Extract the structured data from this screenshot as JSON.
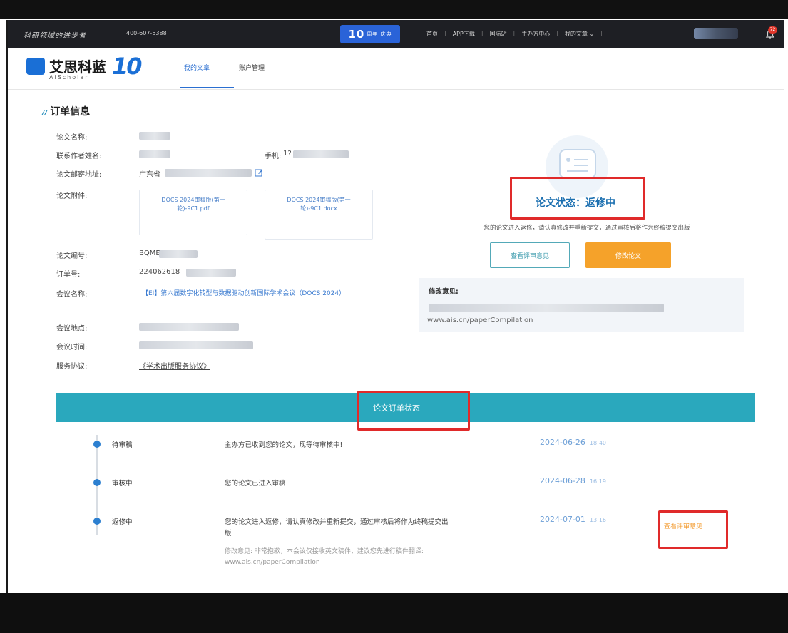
{
  "topbar": {
    "slogan": "科研领域的进步者",
    "phone": "400-607-5388",
    "badge_num": "10",
    "badge_text": "周年 庆典",
    "nav": [
      "首页",
      "APP下载",
      "国际站",
      "主办方中心",
      "我的文章"
    ],
    "notifications": "72"
  },
  "header": {
    "logo_text": "艾思科蓝",
    "logo_sub": "AiScholar",
    "logo_10": "10",
    "tabs": [
      "我的文章",
      "账户管理"
    ]
  },
  "order_info": {
    "title": "订单信息",
    "labels": {
      "paper_name": "论文名称:",
      "contact_name": "联系作者姓名:",
      "phone_label": "手机:",
      "address": "论文邮寄地址:",
      "attachments": "论文附件:",
      "paper_no": "论文编号:",
      "order_no": "订单号:",
      "conf_name": "会议名称:",
      "conf_place": "会议地点:",
      "conf_time": "会议时间:",
      "service": "服务协议:"
    },
    "phone_prefix": "1?",
    "address_prefix": "广东省",
    "attachment_1": "DOCS 2024审稿版(第一轮)-9C1.pdf",
    "attachment_2": "DOCS 2024审稿版(第一轮)-9C1.docx",
    "paper_no_prefix": "BQME",
    "order_no_prefix": "224062618",
    "conf_name_value": "【EI】第六届数字化转型与数据驱动创新国际学术会议（DOCS 2024）",
    "service_value": "《学术出版服务协议》"
  },
  "status_panel": {
    "status": "论文状态：返修中",
    "description": "您的论文进入返修，请认真修改并重新提交，通过审核后将作为终稿提交出版",
    "btn_view": "查看评审意见",
    "btn_edit": "修改论文",
    "comment_label": "修改意见:",
    "comment_url": "www.ais.cn/paperCompilation"
  },
  "order_status": {
    "title": "论文订单状态",
    "items": [
      {
        "status": "待审稿",
        "desc": "主办方已收到您的论文，现等待审核中!",
        "date": "2024-06-26",
        "time": "18:40"
      },
      {
        "status": "审核中",
        "desc": "您的论文已进入审稿",
        "date": "2024-06-28",
        "time": "16:19"
      },
      {
        "status": "返修中",
        "desc": "您的论文进入返修，请认真修改并重新提交，通过审核后将作为终稿提交出",
        "desc2": "版",
        "date": "2024-07-01",
        "time": "13:16",
        "note": "修改意见: 非常抱歉，本会议仅接收英文稿件，建议您先进行稿件翻译:",
        "note2": "www.ais.cn/paperCompilation",
        "action": "查看评审意见"
      }
    ]
  },
  "colors": {
    "topbar": "#1e1f24",
    "accent_blue": "#2b6fd1",
    "teal_banner": "#2aa8bd",
    "orange": "#f5a22a",
    "highlight_red": "#e02a2a"
  }
}
